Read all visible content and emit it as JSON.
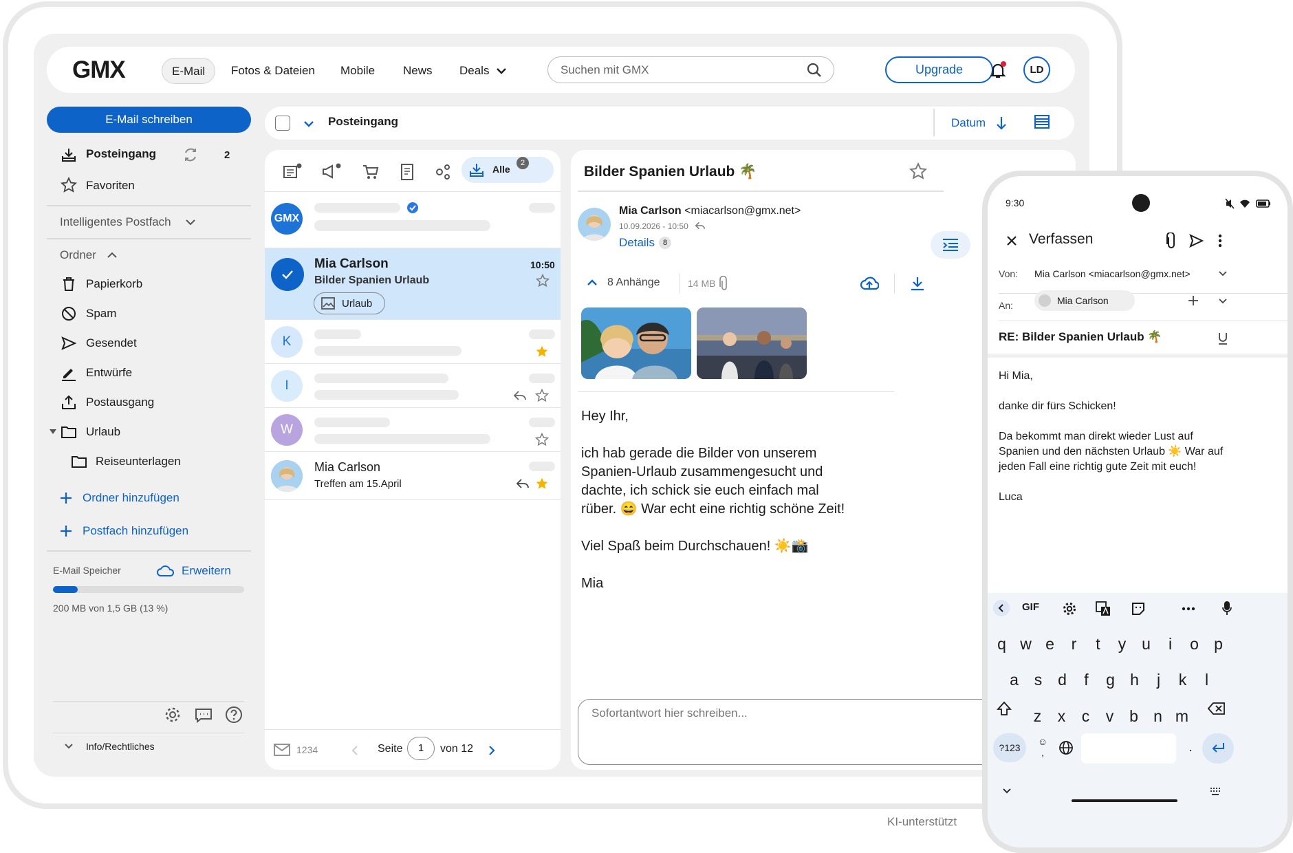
{
  "app": {
    "logo": "GMX"
  },
  "nav": {
    "email": "E-Mail",
    "photos": "Fotos & Dateien",
    "mobile": "Mobile",
    "news": "News",
    "deals": "Deals"
  },
  "search": {
    "placeholder": "Suchen mit GMX"
  },
  "header": {
    "upgrade": "Upgrade",
    "avatar_initials": "LD"
  },
  "sidebar": {
    "compose": "E-Mail schreiben",
    "inbox": "Posteingang",
    "inbox_count": "2",
    "favorites": "Favoriten",
    "smart_inbox": "Intelligentes Postfach",
    "folders_label": "Ordner",
    "folders": [
      "Papierkorb",
      "Spam",
      "Gesendet",
      "Entwürfe",
      "Postausgang",
      "Urlaub",
      "Reiseunterlagen"
    ],
    "add_folder": "Ordner hinzufügen",
    "add_mailbox": "Postfach hinzufügen",
    "storage_label": "E-Mail Speicher",
    "storage_expand": "Erweitern",
    "storage_text": "200 MB von 1,5 GB (13 %)",
    "storage_fraction": 0.13,
    "info": "Info/Rechtliches"
  },
  "listheader": {
    "folder": "Posteingang",
    "sort": "Datum"
  },
  "filters": {
    "all": "Alle",
    "all_count": "2"
  },
  "messages": [
    {
      "avatar": "GMX",
      "verified": true
    },
    {
      "sender": "Mia Carlson",
      "subject": "Bilder Spanien Urlaub",
      "time": "10:50",
      "tag": "Urlaub",
      "selected": true
    },
    {
      "avatar": "K",
      "starred": true
    },
    {
      "avatar": "I",
      "replied": true
    },
    {
      "avatar": "W"
    },
    {
      "sender": "Mia Carlson",
      "subject": "Treffen am 15.April",
      "replied": true,
      "starred": true
    }
  ],
  "pagination": {
    "count": "1234",
    "page_label": "Seite",
    "page": "1",
    "of": "von 12"
  },
  "reader": {
    "subject": "Bilder Spanien Urlaub 🌴",
    "sender_name": "Mia Carlson",
    "sender_email": "<miacarlson@gmx.net>",
    "date": "10.09.2026 - 10:50",
    "details": "Details",
    "details_count": "8",
    "attachments": "8 Anhänge",
    "attachments_size": "14 MB",
    "body_greeting": "Hey Ihr,",
    "body_p1": "ich hab gerade die Bilder von unserem Spanien-Urlaub zusammengesucht und dachte, ich schick sie euch einfach mal rüber. 😄 War echt eine richtig schöne Zeit!",
    "body_p2": "Viel Spaß beim Durchschauen! ☀️📸",
    "body_sign": "Mia",
    "quick_reply_placeholder": "Sofortantwort hier schreiben..."
  },
  "footer": {
    "ai": "KI-unterstützt"
  },
  "phone": {
    "time": "9:30",
    "title": "Verfassen",
    "from_label": "Von:",
    "from_value": "Mia Carlson <miacarlson@gmx.net>",
    "to_label": "An:",
    "to_value": "Mia Carlson",
    "subject": "RE: Bilder Spanien Urlaub 🌴",
    "body_l1": "Hi Mia,",
    "body_l2": "danke dir fürs Schicken!",
    "body_l3": "Da bekommt man direkt wieder Lust auf Spanien und den nächsten Urlaub ☀️ War auf jeden Fall eine richtig gute Zeit mit euch!",
    "body_l4": "Luca",
    "keyboard": {
      "row1": [
        "q",
        "w",
        "e",
        "r",
        "t",
        "y",
        "u",
        "i",
        "o",
        "p"
      ],
      "row2": [
        "a",
        "s",
        "d",
        "f",
        "g",
        "h",
        "j",
        "k",
        "l"
      ],
      "row3": [
        "z",
        "x",
        "c",
        "v",
        "b",
        "n",
        "m"
      ],
      "gif": "GIF",
      "numbers": "?123",
      "comma": ",",
      "period": "."
    }
  },
  "colors": {
    "accent": "#0e63c8",
    "selected_row": "#cfe6fb",
    "star": "#f5b400"
  }
}
